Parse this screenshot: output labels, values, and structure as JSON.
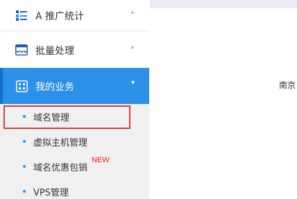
{
  "sidebar": {
    "items": [
      {
        "label": "A 推广统计",
        "icon": "stats-icon"
      },
      {
        "label": "批量处理",
        "icon": "www-window-icon"
      },
      {
        "label": "我的业务",
        "icon": "calendar-grid-icon",
        "active": true
      }
    ],
    "submenu": [
      {
        "label": "域名管理",
        "highlighted": true
      },
      {
        "label": "虚拟主机管理"
      },
      {
        "label": "域名优惠包销",
        "badge": "NEW"
      },
      {
        "label": "VPS管理"
      }
    ]
  },
  "main": {
    "text": "南京"
  },
  "colors": {
    "accent": "#2b90e8",
    "highlight_border": "#e03a3a",
    "badge": "#e8231e",
    "submenu_bg": "#f0f0f0"
  }
}
